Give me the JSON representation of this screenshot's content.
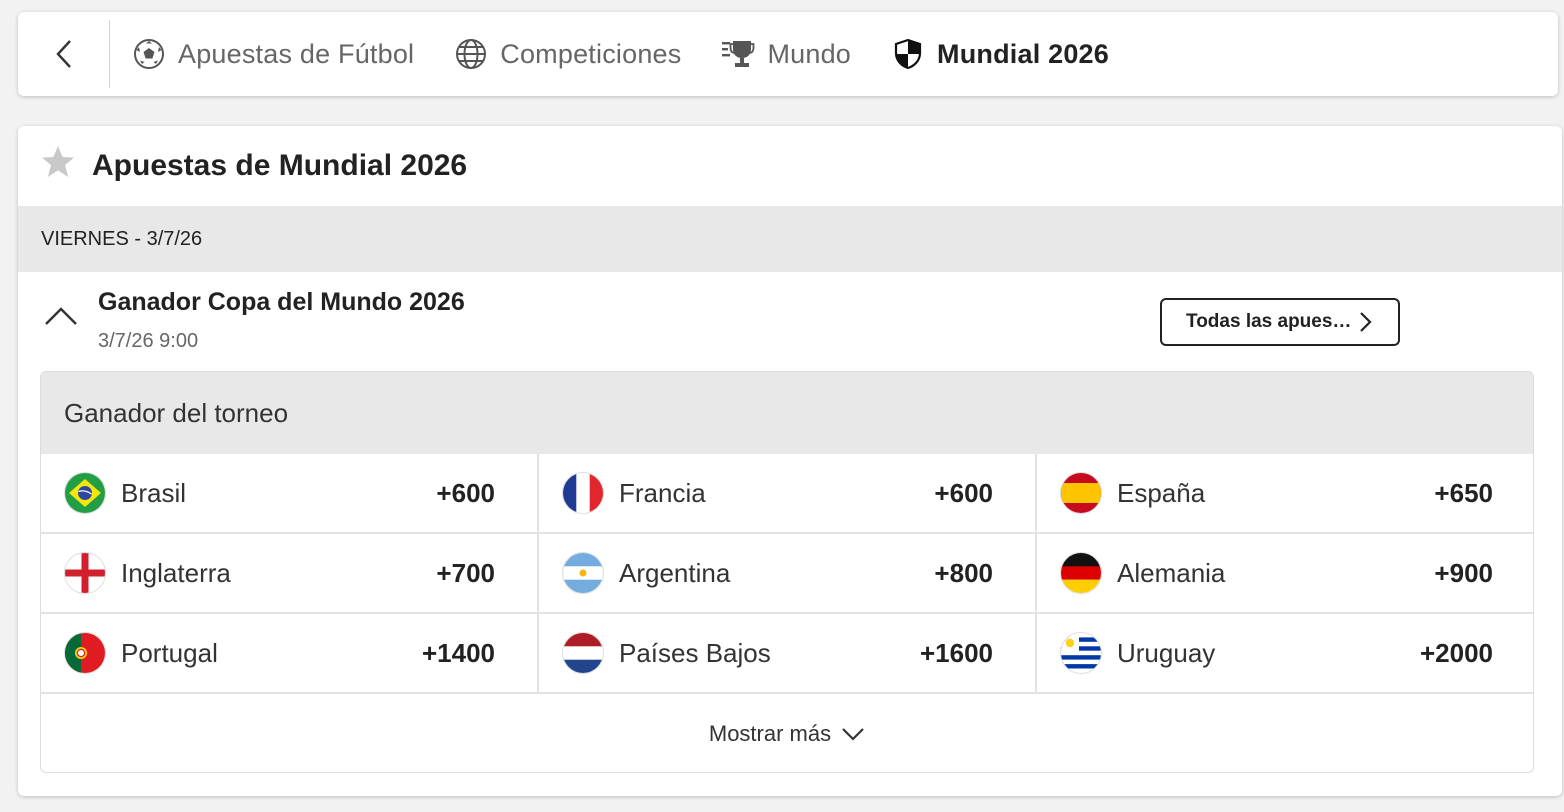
{
  "nav": {
    "crumbs": [
      {
        "label": "Apuestas de Fútbol",
        "icon": "soccer-ball-icon"
      },
      {
        "label": "Competiciones",
        "icon": "globe-icon"
      },
      {
        "label": "Mundo",
        "icon": "trophy-icon"
      },
      {
        "label": "Mundial 2026",
        "icon": "shield-icon",
        "active": true
      }
    ]
  },
  "page": {
    "title": "Apuestas de Mundial 2026",
    "date_label": "VIERNES - 3/7/26"
  },
  "event": {
    "title": "Ganador Copa del Mundo 2026",
    "time": "3/7/26 9:00",
    "all_bets_label": "Todas las apues…"
  },
  "market": {
    "title": "Ganador del torneo",
    "selections": [
      {
        "team": "Brasil",
        "odds": "+600",
        "flag": "brazil"
      },
      {
        "team": "Francia",
        "odds": "+600",
        "flag": "france"
      },
      {
        "team": "España",
        "odds": "+650",
        "flag": "spain"
      },
      {
        "team": "Inglaterra",
        "odds": "+700",
        "flag": "england"
      },
      {
        "team": "Argentina",
        "odds": "+800",
        "flag": "argentina"
      },
      {
        "team": "Alemania",
        "odds": "+900",
        "flag": "germany"
      },
      {
        "team": "Portugal",
        "odds": "+1400",
        "flag": "portugal"
      },
      {
        "team": "Países Bajos",
        "odds": "+1600",
        "flag": "netherlands"
      },
      {
        "team": "Uruguay",
        "odds": "+2000",
        "flag": "uruguay"
      }
    ],
    "show_more_label": "Mostrar más"
  },
  "colors": {
    "background": "#f2f2f2",
    "panel_gray": "#e8e8e8",
    "text": "#222222",
    "muted": "#666666"
  }
}
